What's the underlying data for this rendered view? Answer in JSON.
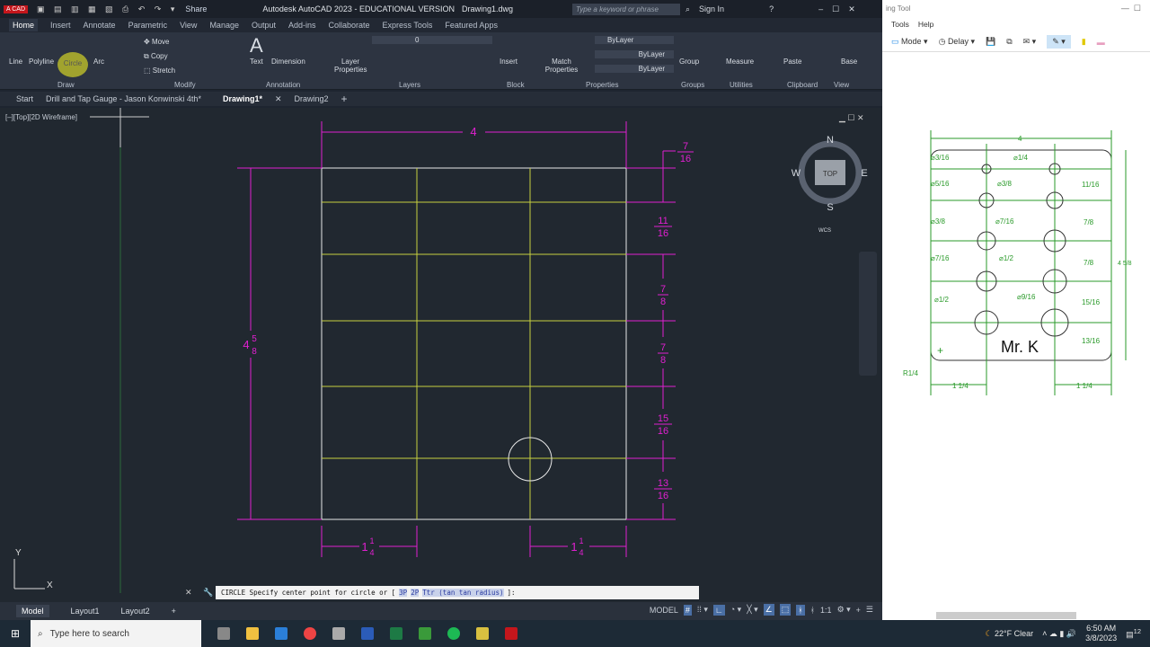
{
  "app": {
    "logo": "A CAD",
    "title": "Autodesk AutoCAD 2023 - EDUCATIONAL VERSION",
    "file": "Drawing1.dwg",
    "share": "Share",
    "search_placeholder": "Type a keyword or phrase",
    "sign_in": "Sign In"
  },
  "ribbon_tabs": [
    "Home",
    "Insert",
    "Annotate",
    "Parametric",
    "View",
    "Manage",
    "Output",
    "Add-ins",
    "Collaborate",
    "Express Tools",
    "Featured Apps"
  ],
  "ribbon": {
    "draw": {
      "tools": [
        "Line",
        "Polyline",
        "Circle",
        "Arc"
      ],
      "label": "Draw"
    },
    "modify": {
      "tools": [
        "Move",
        "Copy",
        "Stretch"
      ],
      "label": "Modify"
    },
    "annotation": {
      "tools": [
        "Text",
        "Dimension"
      ],
      "label": "Annotation"
    },
    "layers": {
      "tools": [
        "Layer Properties"
      ],
      "current_layer": "0",
      "label": "Layers"
    },
    "block": {
      "tools": [
        "Insert"
      ],
      "label": "Block"
    },
    "properties": {
      "tools": [
        "Match Properties"
      ],
      "color": "ByLayer",
      "linetype": "ByLayer",
      "lineweight": "ByLayer",
      "label": "Properties"
    },
    "groups": {
      "tools": [
        "Group"
      ],
      "label": "Groups"
    },
    "utilities": {
      "tools": [
        "Measure"
      ],
      "label": "Utilities"
    },
    "clipboard": {
      "tools": [
        "Paste"
      ],
      "label": "Clipboard"
    },
    "view": {
      "tools": [
        "Base"
      ],
      "label": "View"
    }
  },
  "doc_tabs": [
    "Start",
    "Drill and Tap Gauge - Jason Konwinski 4th*",
    "Drawing1*",
    "Drawing2"
  ],
  "viewport": {
    "label": "[–][Top][2D Wireframe]",
    "viewcube": {
      "top": "TOP",
      "n": "N",
      "s": "S",
      "e": "E",
      "w": "W",
      "wcs": "WCS"
    },
    "ucs_x": "X",
    "ucs_y": "Y"
  },
  "drawing": {
    "width": "4",
    "height": {
      "whole": "4",
      "num": "5",
      "den": "8"
    },
    "spacings": [
      {
        "num": "7",
        "den": "16"
      },
      {
        "num": "11",
        "den": "16"
      },
      {
        "num": "7",
        "den": "8"
      },
      {
        "num": "7",
        "den": "8"
      },
      {
        "num": "15",
        "den": "16"
      },
      {
        "num": "13",
        "den": "16"
      }
    ],
    "offset_left": {
      "whole": "1",
      "num": "1",
      "den": "4"
    },
    "offset_right": {
      "whole": "1",
      "num": "1",
      "den": "4"
    }
  },
  "command_line": {
    "command": "CIRCLE Specify center point for circle or [",
    "options": [
      "3P",
      "2P",
      "Ttr (tan tan radius)"
    ],
    "end": "]:"
  },
  "layout_tabs": [
    "Model",
    "Layout1",
    "Layout2"
  ],
  "status_bar": {
    "model": "MODEL",
    "scale": "1:1"
  },
  "snip": {
    "title": "ing Tool",
    "menu": [
      "Tools",
      "Help"
    ],
    "mode": "Mode",
    "delay": "Delay",
    "ref": {
      "width": "4",
      "height": "4 5/8",
      "holes": [
        "⌀3/16",
        "⌀1/4",
        "⌀5/16",
        "⌀3/8",
        "⌀3/8",
        "⌀7/16",
        "⌀7/16",
        "⌀1/2",
        "⌀1/2",
        "⌀9/16"
      ],
      "spacings": [
        "11/16",
        "7/8",
        "7/8",
        "15/16",
        "13/16"
      ],
      "radius": "R1/4",
      "offset_left": "1 1/4",
      "offset_right": "1 1/4",
      "name": "Mr. K"
    }
  },
  "taskbar": {
    "search": "Type here to search",
    "weather": "22°F  Clear",
    "time": "6:50 AM",
    "date": "3/8/2023",
    "notifications": "12"
  },
  "colors": {
    "dim": "#e020d0",
    "lines": "#c8d040",
    "ref_green": "#2a9a2a"
  }
}
